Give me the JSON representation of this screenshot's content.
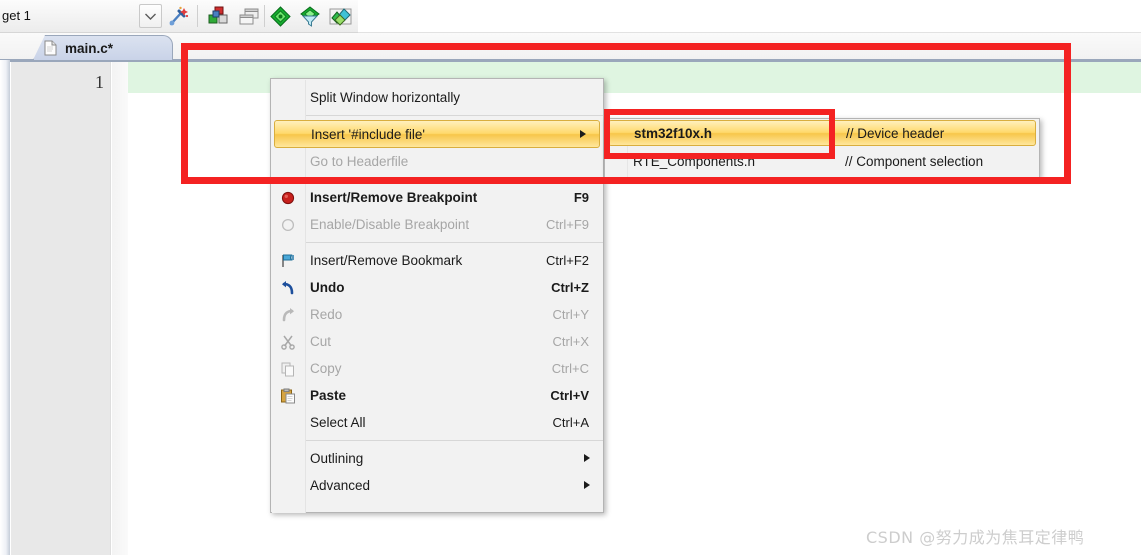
{
  "toolbar": {
    "target_label": "get 1",
    "dropdown_icon": "chevron-down-icon",
    "buttons": [
      {
        "name": "target-options-icon",
        "title": "Configure target options"
      },
      {
        "name": "manage-components-icon",
        "title": "Manage Run-Time Environment"
      },
      {
        "name": "manage-project-items-icon",
        "title": "Manage project items"
      },
      {
        "name": "build-target-icon",
        "title": "Build target"
      },
      {
        "name": "rebuild-icon",
        "title": "Rebuild all target files"
      },
      {
        "name": "batch-build-icon",
        "title": "Batch build"
      }
    ]
  },
  "tab": {
    "label": "main.c*",
    "icon": "document-icon"
  },
  "editor": {
    "line_numbers": [
      "1"
    ],
    "current_line_color": "#dff5e1",
    "gutter_color": "#e8e8e8"
  },
  "context_menu": {
    "groups": [
      {
        "items": [
          {
            "label": "Split Window horizontally",
            "accel": "",
            "icon": "",
            "state": "normal",
            "submenu": false
          }
        ]
      },
      {
        "items": [
          {
            "label": "Insert '#include file'",
            "accel": "",
            "icon": "",
            "state": "highlight",
            "submenu": true
          },
          {
            "label": "Go to Headerfile",
            "accel": "",
            "icon": "",
            "state": "disabled",
            "submenu": false
          }
        ]
      },
      {
        "items": [
          {
            "label": "Insert/Remove Breakpoint",
            "accel": "F9",
            "icon": "breakpoint-icon",
            "state": "bold",
            "submenu": false
          },
          {
            "label": "Enable/Disable Breakpoint",
            "accel": "Ctrl+F9",
            "icon": "breakpoint-disabled-icon",
            "state": "disabled",
            "submenu": false
          }
        ]
      },
      {
        "items": [
          {
            "label": "Insert/Remove Bookmark",
            "accel": "Ctrl+F2",
            "icon": "bookmark-flag-icon",
            "state": "normal",
            "submenu": false
          },
          {
            "label": "Undo",
            "accel": "Ctrl+Z",
            "icon": "undo-icon",
            "state": "bold",
            "submenu": false
          },
          {
            "label": "Redo",
            "accel": "Ctrl+Y",
            "icon": "redo-icon",
            "state": "disabled",
            "submenu": false
          },
          {
            "label": "Cut",
            "accel": "Ctrl+X",
            "icon": "scissors-icon",
            "state": "disabled",
            "submenu": false
          },
          {
            "label": "Copy",
            "accel": "Ctrl+C",
            "icon": "copy-icon",
            "state": "disabled",
            "submenu": false
          },
          {
            "label": "Paste",
            "accel": "Ctrl+V",
            "icon": "paste-icon",
            "state": "bold",
            "submenu": false
          },
          {
            "label": "Select All",
            "accel": "Ctrl+A",
            "icon": "",
            "state": "normal",
            "submenu": false
          }
        ]
      },
      {
        "items": [
          {
            "label": "Outlining",
            "accel": "",
            "icon": "",
            "state": "normal",
            "submenu": true
          },
          {
            "label": "Advanced",
            "accel": "",
            "icon": "",
            "state": "normal",
            "submenu": true
          }
        ]
      }
    ]
  },
  "submenu": {
    "items": [
      {
        "name": "stm32f10x.h",
        "comment": "// Device header",
        "state": "highlight"
      },
      {
        "name": "RTE_Components.h",
        "comment": "// Component selection",
        "state": "normal"
      }
    ]
  },
  "annotations": {
    "color": "#f42222",
    "outer_box_label": "highlight-insert-include-region",
    "inner_box_label": "highlight-stm32f10x-header"
  },
  "watermark": {
    "text": "CSDN @努力成为焦耳定律鸭"
  }
}
